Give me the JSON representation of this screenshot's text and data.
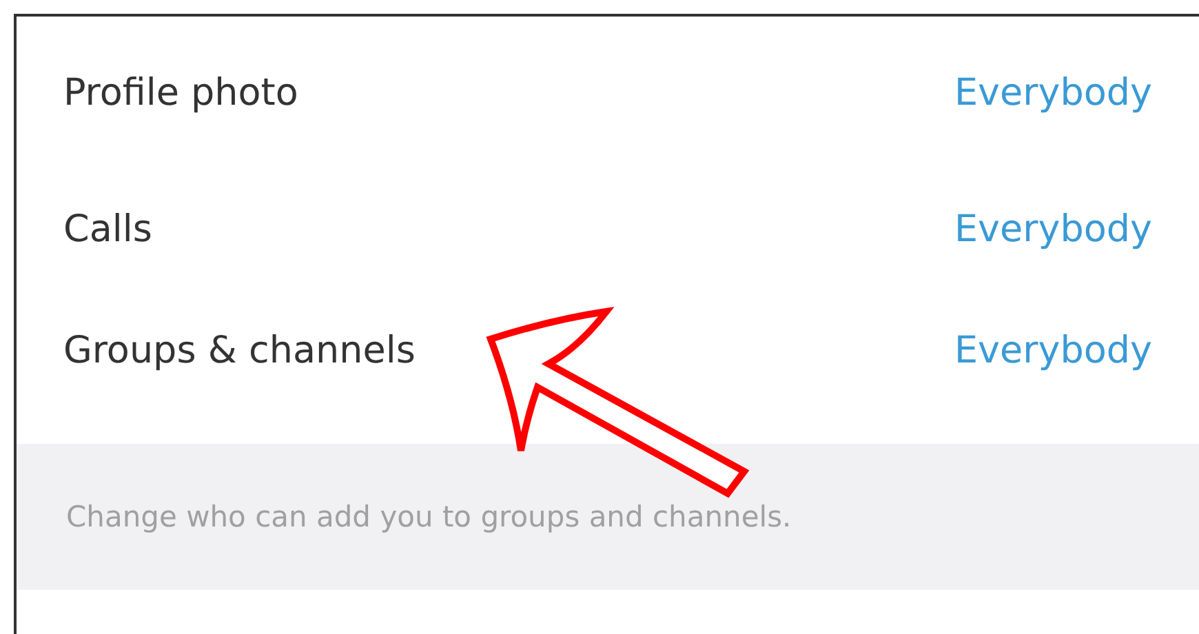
{
  "settings": [
    {
      "label": "Profile photo",
      "value": "Everybody"
    },
    {
      "label": "Calls",
      "value": "Everybody"
    },
    {
      "label": "Groups & channels",
      "value": "Everybody"
    }
  ],
  "hint": "Change who can add you to groups and channels."
}
